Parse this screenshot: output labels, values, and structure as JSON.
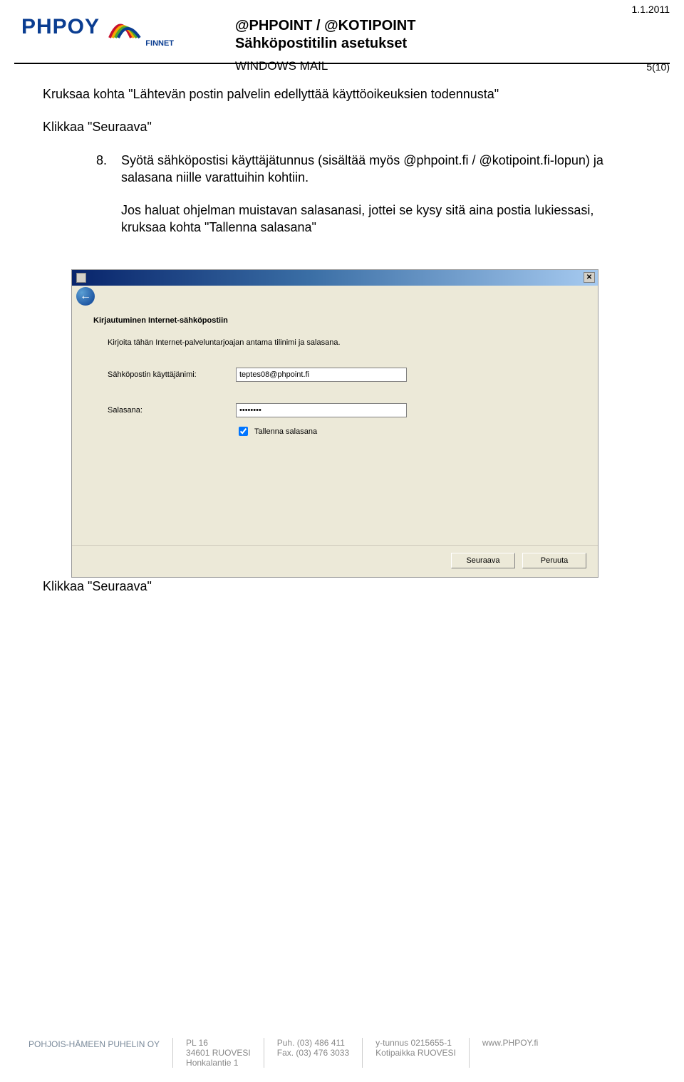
{
  "header": {
    "logo_brand": "PHPOY",
    "logo_sub": "FINNET",
    "title_line1": "@PHPOINT / @KOTIPOINT",
    "title_line2": "Sähköpostitilin asetukset",
    "title_line3": "WINDOWS MAIL",
    "date": "1.1.2011",
    "page_counter": "5(10)"
  },
  "body": {
    "para1": "Kruksaa kohta \"Lähtevän postin palvelin edellyttää käyttöoikeuksien todennusta\"",
    "para2": "Klikkaa \"Seuraava\"",
    "step_number": "8.",
    "step_text1": "Syötä sähköpostisi käyttäjätunnus (sisältää myös @phpoint.fi / @kotipoint.fi-lopun) ja salasana niille varattuihin kohtiin.",
    "step_text2": "Jos haluat ohjelman muistavan salasanasi, jottei se kysy sitä aina postia lukiessasi, kruksaa kohta \"Tallenna salasana\"",
    "after_wizard": "Klikkaa \"Seuraava\""
  },
  "wizard": {
    "heading": "Kirjautuminen Internet-sähköpostiin",
    "subtext": "Kirjoita tähän Internet-palveluntarjoajan antama tilinimi ja salasana.",
    "username_label": "Sähköpostin käyttäjänimi:",
    "username_value": "teptes08@phpoint.fi",
    "password_label": "Salasana:",
    "password_value": "••••••••",
    "remember_label": "Tallenna salasana",
    "button_next": "Seuraava",
    "button_cancel": "Peruuta"
  },
  "footer": {
    "company": "POHJOIS-HÄMEEN PUHELIN OY",
    "addr1": "PL 16",
    "addr2": "34601 RUOVESI",
    "addr3": "Honkalantie 1",
    "phone": "Puh. (03) 486 411",
    "fax": "Fax. (03) 476 3033",
    "ytunnus": "y-tunnus 0215655-1",
    "kotipaikka": "Kotipaikka RUOVESI",
    "web": "www.PHPOY.fi"
  }
}
